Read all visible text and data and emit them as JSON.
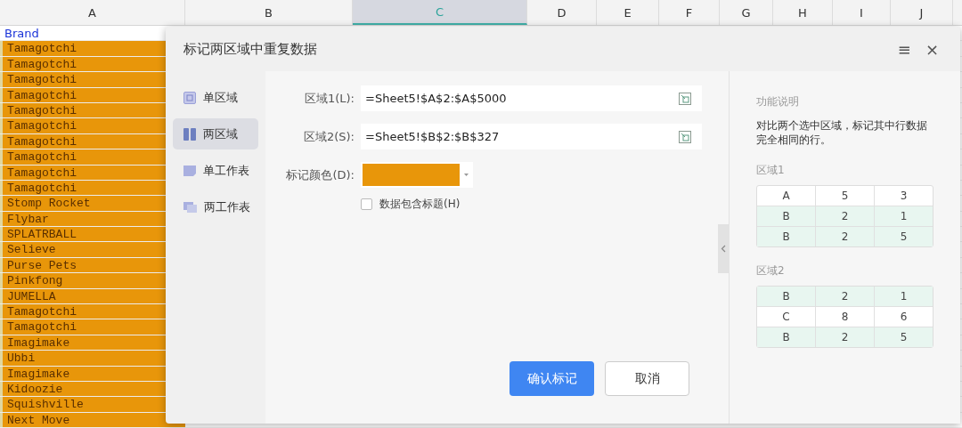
{
  "sheet": {
    "columns": [
      {
        "label": "A",
        "selected": false
      },
      {
        "label": "B",
        "selected": false
      },
      {
        "label": "C",
        "selected": true
      },
      {
        "label": "D",
        "selected": false
      },
      {
        "label": "E",
        "selected": false
      },
      {
        "label": "F",
        "selected": false
      },
      {
        "label": "G",
        "selected": false
      },
      {
        "label": "H",
        "selected": false
      },
      {
        "label": "I",
        "selected": false
      },
      {
        "label": "J",
        "selected": false
      }
    ],
    "rows": [
      {
        "text": "Brand",
        "marked": false
      },
      {
        "text": "Tamagotchi",
        "marked": true
      },
      {
        "text": "Tamagotchi",
        "marked": true
      },
      {
        "text": "Tamagotchi",
        "marked": true
      },
      {
        "text": "Tamagotchi",
        "marked": true
      },
      {
        "text": "Tamagotchi",
        "marked": true
      },
      {
        "text": "Tamagotchi",
        "marked": true
      },
      {
        "text": "Tamagotchi",
        "marked": true
      },
      {
        "text": "Tamagotchi",
        "marked": true
      },
      {
        "text": "Tamagotchi",
        "marked": true
      },
      {
        "text": "Tamagotchi",
        "marked": true
      },
      {
        "text": "Stomp Rocket",
        "marked": true
      },
      {
        "text": "Flybar",
        "marked": true
      },
      {
        "text": "SPLATRBALL",
        "marked": true
      },
      {
        "text": "Selieve",
        "marked": true
      },
      {
        "text": "Purse Pets",
        "marked": true
      },
      {
        "text": "Pinkfong",
        "marked": true
      },
      {
        "text": "JUMELLA",
        "marked": true
      },
      {
        "text": "Tamagotchi",
        "marked": true
      },
      {
        "text": "Tamagotchi",
        "marked": true
      },
      {
        "text": "Imagimake",
        "marked": true
      },
      {
        "text": "Ubbi",
        "marked": true
      },
      {
        "text": "Imagimake",
        "marked": true
      },
      {
        "text": "Kidoozie",
        "marked": true
      },
      {
        "text": "Squishville",
        "marked": true
      },
      {
        "text": "Next Move",
        "marked": true
      }
    ]
  },
  "dialog": {
    "title": "标记两区域中重复数据",
    "menu_icon": "≡",
    "close_icon": "×",
    "nav": [
      {
        "label": "单区域",
        "selected": false
      },
      {
        "label": "两区域",
        "selected": true
      },
      {
        "label": "单工作表",
        "selected": false
      },
      {
        "label": "两工作表",
        "selected": false
      }
    ],
    "fields": [
      {
        "kind": "range",
        "label": "区域1(L):",
        "value": "=Sheet5!$A$2:$A$5000"
      },
      {
        "kind": "range",
        "label": "区域2(S):",
        "value": "=Sheet5!$B$2:$B$327"
      },
      {
        "kind": "color",
        "label": "标记颜色(D):",
        "color": "#e8960a"
      }
    ],
    "checkbox": {
      "label": "数据包含标题(H)",
      "checked": false
    },
    "buttons": [
      {
        "kind": "primary",
        "label": "确认标记"
      },
      {
        "kind": "secondary",
        "label": "取消"
      }
    ],
    "help": {
      "title": "功能说明",
      "text": "对比两个选中区域，标记其中行数据完全相同的行。",
      "examples": [
        {
          "label": "区域1",
          "rows": [
            {
              "cells": [
                "A",
                "5",
                "3"
              ],
              "highlighted": false
            },
            {
              "cells": [
                "B",
                "2",
                "1"
              ],
              "highlighted": true
            },
            {
              "cells": [
                "B",
                "2",
                "5"
              ],
              "highlighted": true
            }
          ]
        },
        {
          "label": "区域2",
          "rows": [
            {
              "cells": [
                "B",
                "2",
                "1"
              ],
              "highlighted": true
            },
            {
              "cells": [
                "C",
                "8",
                "6"
              ],
              "highlighted": false
            },
            {
              "cells": [
                "B",
                "2",
                "5"
              ],
              "highlighted": true
            }
          ]
        }
      ]
    }
  }
}
